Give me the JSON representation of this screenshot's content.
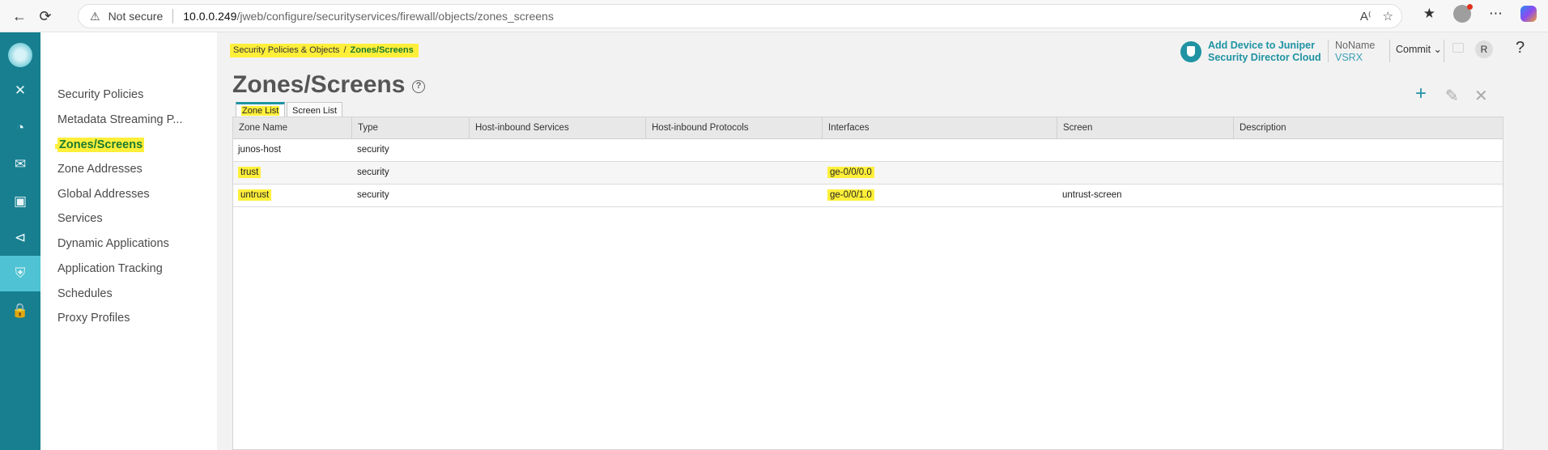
{
  "browser": {
    "not_secure": "Not secure",
    "url_host": "10.0.0.249",
    "url_path": "/jweb/configure/securityservices/firewall/objects/zones_screens"
  },
  "subnav": {
    "items": [
      {
        "label": "Security Policies"
      },
      {
        "label": "Metadata Streaming P..."
      },
      {
        "label": "Zones/Screens",
        "active": true
      },
      {
        "label": "Zone Addresses"
      },
      {
        "label": "Global Addresses"
      },
      {
        "label": "Services"
      },
      {
        "label": "Dynamic Applications"
      },
      {
        "label": "Application Tracking"
      },
      {
        "label": "Schedules"
      },
      {
        "label": "Proxy Profiles"
      }
    ]
  },
  "breadcrumb": {
    "parent": "Security Policies & Objects",
    "separator": "/",
    "current": "Zones/Screens"
  },
  "page": {
    "title": "Zones/Screens",
    "help": "?"
  },
  "header": {
    "add_device_line1": "Add Device to Juniper",
    "add_device_line2": "Security Director Cloud",
    "device_name": "NoName",
    "device_type": "VSRX",
    "commit_label": "Commit",
    "user_initial": "R",
    "help": "?"
  },
  "tabs": [
    {
      "label": "Zone List",
      "active": true
    },
    {
      "label": "Screen List",
      "active": false
    }
  ],
  "grid": {
    "columns": [
      "Zone Name",
      "Type",
      "Host-inbound Services",
      "Host-inbound Protocols",
      "Interfaces",
      "Screen",
      "Description"
    ],
    "rows": [
      {
        "zone": "junos-host",
        "type": "security",
        "services": "",
        "protocols": "",
        "interfaces": "",
        "screen": "",
        "description": ""
      },
      {
        "zone": "trust",
        "type": "security",
        "services": "",
        "protocols": "",
        "interfaces": "ge-0/0/0.0",
        "screen": "",
        "description": ""
      },
      {
        "zone": "untrust",
        "type": "security",
        "services": "",
        "protocols": "",
        "interfaces": "ge-0/0/1.0",
        "screen": "untrust-screen",
        "description": ""
      }
    ]
  },
  "colors": {
    "rail": "#177f90",
    "rail_active": "#4fc3d3",
    "accent": "#1f93a3",
    "highlight": "#ffef3a"
  }
}
